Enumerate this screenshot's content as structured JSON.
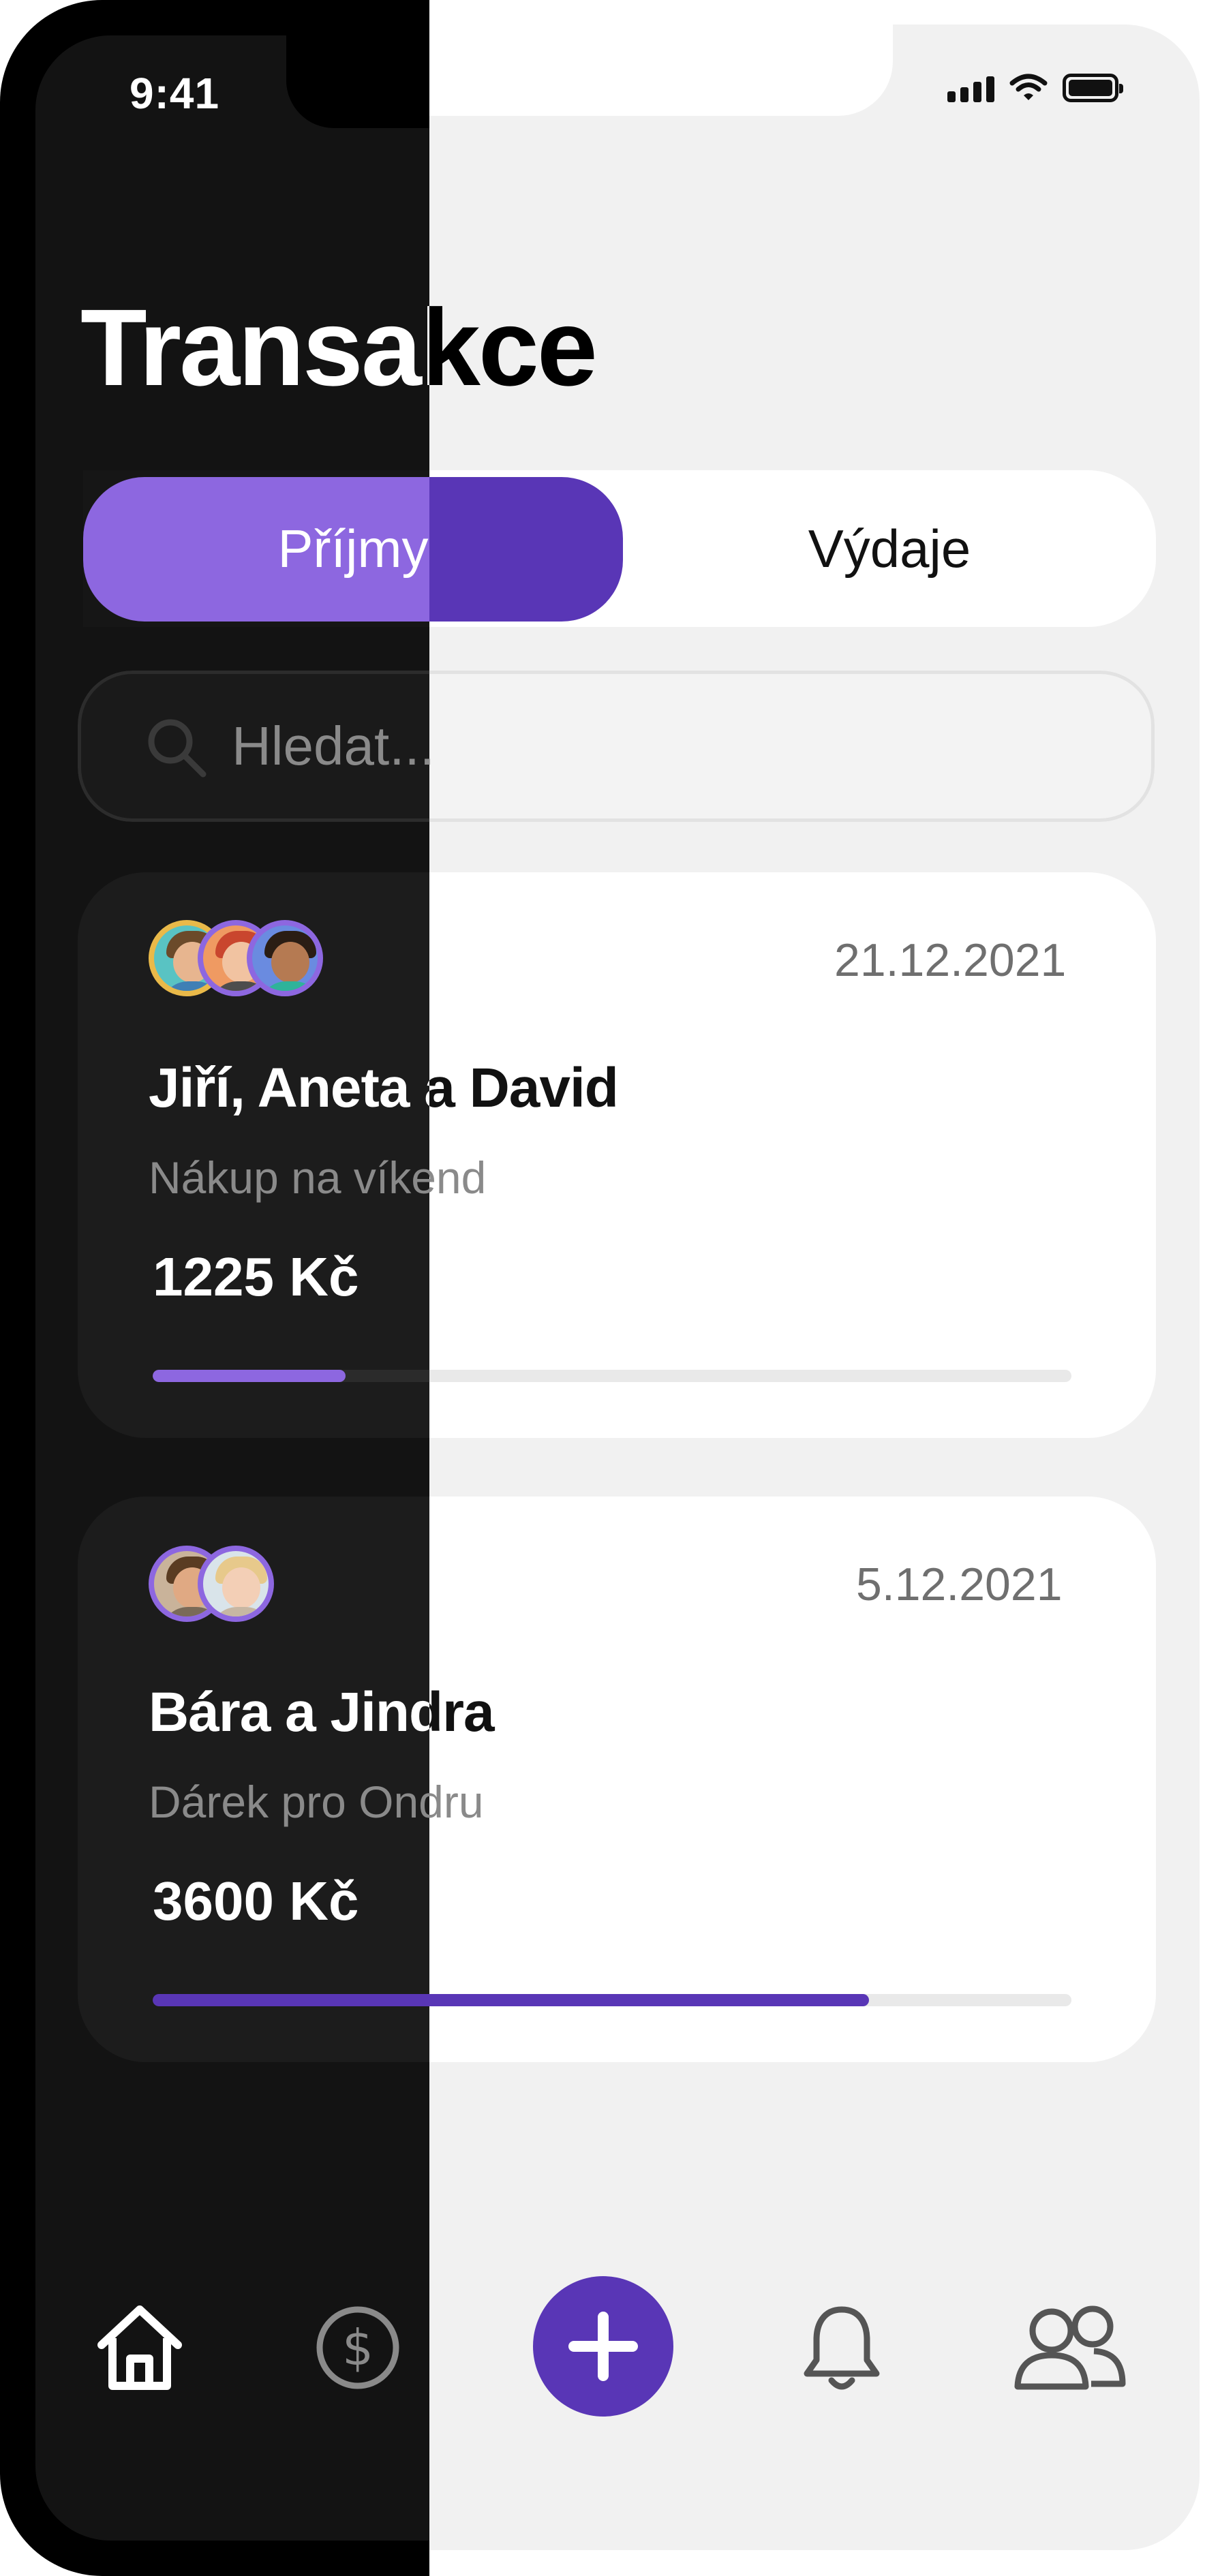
{
  "status_bar": {
    "time": "9:41"
  },
  "header": {
    "title": "Transakce"
  },
  "tabs": {
    "income": "Příjmy",
    "expense": "Výdaje",
    "active": "income"
  },
  "search": {
    "placeholder": "Hledat..."
  },
  "transactions": [
    {
      "avatars": [
        "avatar-jiri",
        "avatar-aneta",
        "avatar-david"
      ],
      "date": "21.12.2021",
      "names": "Jiří, Aneta a David",
      "description": "Nákup na víkend",
      "amount": "1225 Kč",
      "progress": 0.21,
      "progress_color": "#8d67e0"
    },
    {
      "avatars": [
        "avatar-bara",
        "avatar-jindra"
      ],
      "date": "5.12.2021",
      "names": "Bára a Jindra",
      "description": "Dárek pro Ondru",
      "amount": "3600 Kč",
      "progress": 0.78,
      "progress_color": "#5936b6"
    }
  ],
  "nav": {
    "items": [
      "home-icon",
      "dollar-icon",
      "add-icon",
      "bell-icon",
      "people-icon"
    ],
    "active": "home-icon"
  },
  "colors": {
    "accent": "#8d67e0",
    "accent_dark": "#5936b6",
    "dark_bg": "#131313",
    "light_bg": "#f1f1f1"
  }
}
